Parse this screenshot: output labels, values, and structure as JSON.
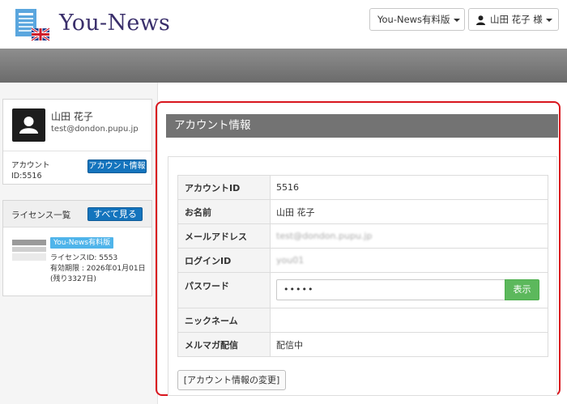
{
  "header": {
    "brand": "You-News",
    "plan_menu_label": "You-News有料版",
    "user_menu_label": "山田 花子 様"
  },
  "sidebar": {
    "user": {
      "name": "山田 花子",
      "email": "test@dondon.pupu.jp",
      "account_label": "アカウント",
      "account_id_label": "ID:5516",
      "account_button": "アカウント情報"
    },
    "licenses": {
      "title": "ライセンス一覧",
      "view_all_button": "すべて見る",
      "items": [
        {
          "badge": "You-News有料版",
          "license_id": "ライセンスID: 5553",
          "expiry": "有効期限 : 2026年01月01日",
          "remaining": "(残り3327日)"
        }
      ]
    }
  },
  "main": {
    "section_title": "アカウント情報",
    "rows": [
      {
        "label": "アカウントID",
        "value": "5516"
      },
      {
        "label": "お名前",
        "value": "山田 花子"
      },
      {
        "label": "メールアドレス",
        "value": "test@dondon.pupu.jp"
      },
      {
        "label": "ログインID",
        "value": "you01"
      },
      {
        "label": "パスワード",
        "value": "•••••"
      },
      {
        "label": "ニックネーム",
        "value": ""
      },
      {
        "label": "メルマガ配信",
        "value": "配信中"
      }
    ],
    "show_password_button": "表示",
    "change_button": "[アカウント情報の変更]"
  },
  "colors": {
    "accent_red": "#d9161e",
    "primary_blue": "#1474bd",
    "success_green": "#5cb85c",
    "badge_blue": "#4fb4ea",
    "brand_purple": "#3a2f6b"
  }
}
